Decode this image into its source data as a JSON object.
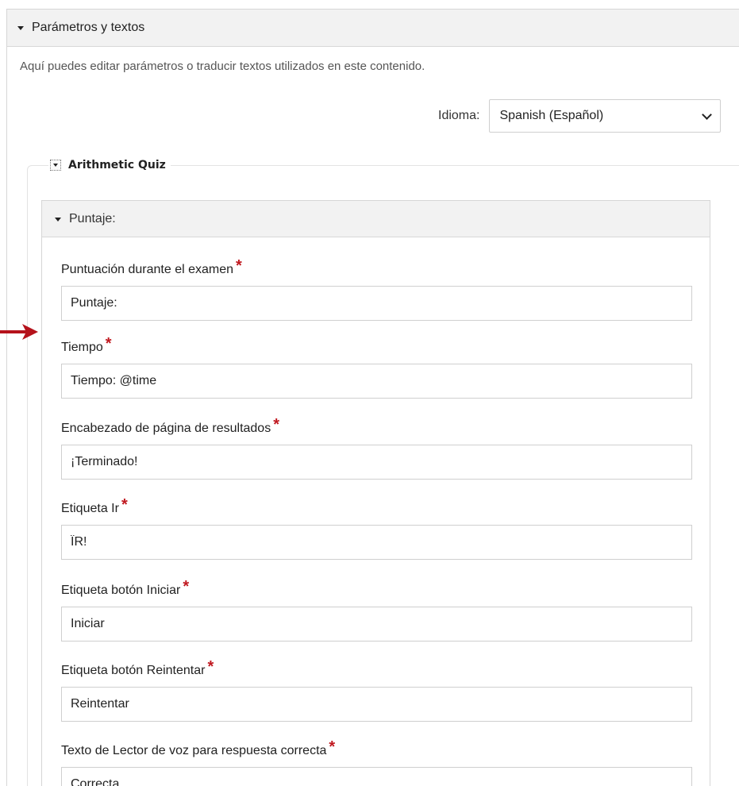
{
  "section": {
    "title": "Parámetros y textos",
    "description": "Aquí puedes editar parámetros o traducir textos utilizados en este contenido."
  },
  "language": {
    "label": "Idioma:",
    "selected": "Spanish (Español)"
  },
  "group": {
    "title": "Arithmetic Quiz"
  },
  "subsection": {
    "title": "Puntaje:"
  },
  "fields": [
    {
      "label": "Puntuación durante el examen",
      "value": "Puntaje:"
    },
    {
      "label": "Tiempo",
      "value": "Tiempo: @time"
    },
    {
      "label": "Encabezado de página de resultados",
      "value": "¡Terminado!"
    },
    {
      "label": "Etiqueta Ir",
      "value": "ÏR!"
    },
    {
      "label": "Etiqueta botón Iniciar",
      "value": "Iniciar"
    },
    {
      "label": "Etiqueta botón Reintentar",
      "value": "Reintentar"
    },
    {
      "label": "Texto de Lector de voz para respuesta correcta",
      "value": "Correcta"
    }
  ],
  "required_marker": "*",
  "colors": {
    "required": "#c0181f",
    "arrow": "#b5121b",
    "header_bg": "#f2f2f2"
  },
  "icons": [
    "caret-down-icon",
    "chevron-down-icon",
    "collapse-toggle-icon",
    "red-arrow-icon"
  ]
}
